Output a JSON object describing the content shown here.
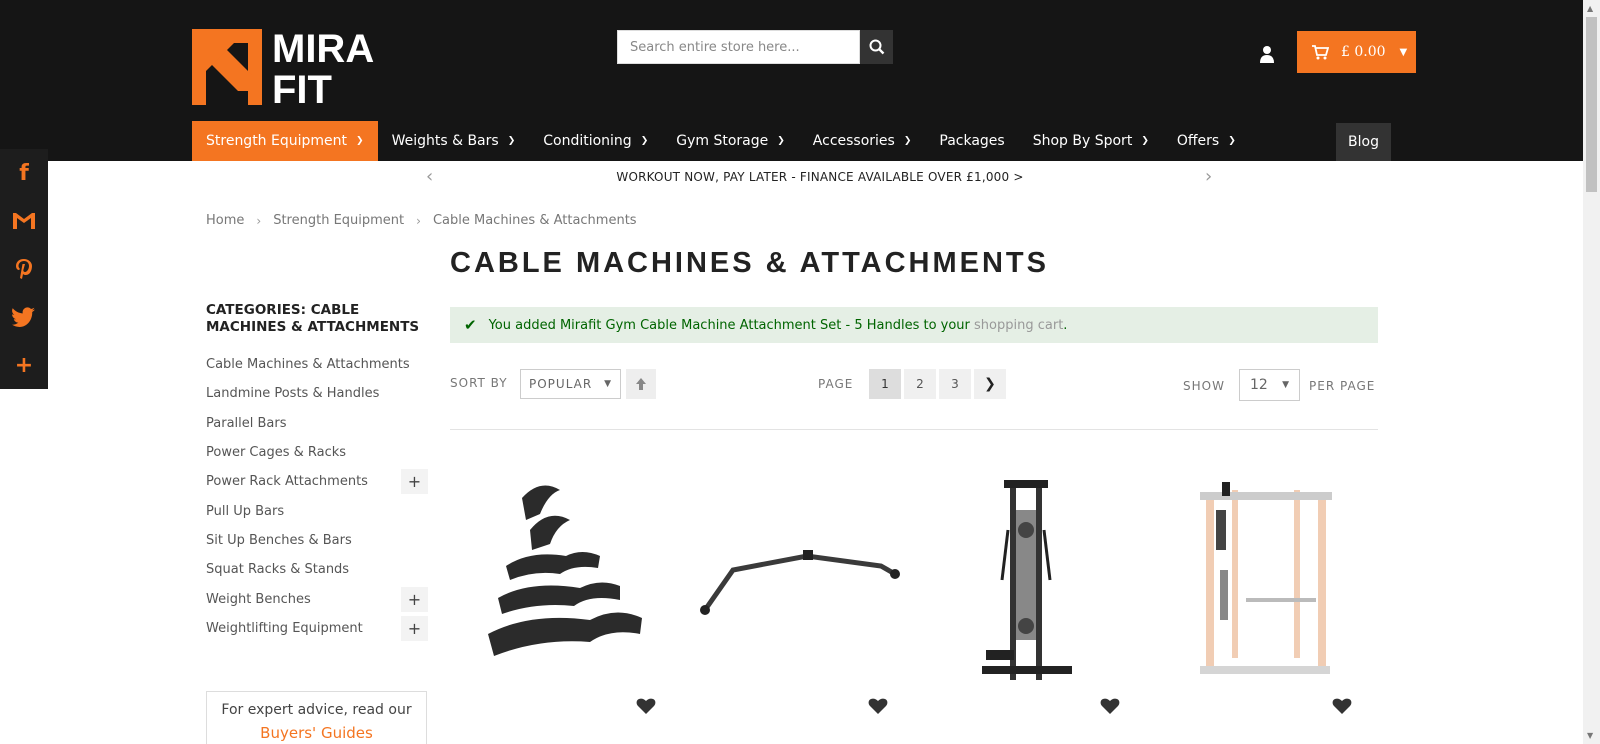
{
  "brand": {
    "logo_line1": "MIRA",
    "logo_line2": "FIT",
    "accent": "#f47521"
  },
  "search": {
    "placeholder": "Search entire store here..."
  },
  "cart": {
    "total": "£ 0.00"
  },
  "nav": {
    "items": [
      {
        "label": "Strength Equipment",
        "dropdown": true
      },
      {
        "label": "Weights & Bars",
        "dropdown": true
      },
      {
        "label": "Conditioning",
        "dropdown": true
      },
      {
        "label": "Gym Storage",
        "dropdown": true
      },
      {
        "label": "Accessories",
        "dropdown": true
      },
      {
        "label": "Packages",
        "dropdown": false
      },
      {
        "label": "Shop By Sport",
        "dropdown": true
      },
      {
        "label": "Offers",
        "dropdown": true
      }
    ],
    "blog": "Blog"
  },
  "promo": {
    "text": "WORKOUT NOW, PAY LATER - FINANCE AVAILABLE OVER £1,000 >"
  },
  "breadcrumb": [
    "Home",
    "Strength Equipment",
    "Cable Machines & Attachments"
  ],
  "page_title": "CABLE MACHINES & ATTACHMENTS",
  "sidebar": {
    "title": "CATEGORIES: CABLE MACHINES & ATTACHMENTS",
    "categories": [
      {
        "label": "Cable Machines & Attachments",
        "expandable": false
      },
      {
        "label": "Landmine Posts & Handles",
        "expandable": false
      },
      {
        "label": "Parallel Bars",
        "expandable": false
      },
      {
        "label": "Power Cages & Racks",
        "expandable": false
      },
      {
        "label": "Power Rack Attachments",
        "expandable": true
      },
      {
        "label": "Pull Up Bars",
        "expandable": false
      },
      {
        "label": "Sit Up Benches & Bars",
        "expandable": false
      },
      {
        "label": "Squat Racks & Stands",
        "expandable": false
      },
      {
        "label": "Weight Benches",
        "expandable": true
      },
      {
        "label": "Weightlifting Equipment",
        "expandable": true
      }
    ],
    "advice_text": "For expert advice, read our",
    "advice_link": "Buyers' Guides"
  },
  "message": {
    "text": "You added Mirafit Gym Cable Machine Attachment Set - 5 Handles to your ",
    "link": "shopping cart",
    "end": "."
  },
  "toolbar": {
    "sort_label": "SORT BY",
    "sort_value": "POPULAR",
    "page_label": "PAGE",
    "pages": [
      "1",
      "2",
      "3"
    ],
    "current_page": "1",
    "show_label": "SHOW",
    "show_value": "12",
    "per_page_label": "PER PAGE"
  },
  "products": [
    {
      "image": "cable-attachment-handles-set"
    },
    {
      "image": "lat-pulldown-bar"
    },
    {
      "image": "cable-tower-machine"
    },
    {
      "image": "power-cage-with-cable"
    }
  ],
  "social": [
    "facebook-icon",
    "gmail-icon",
    "pinterest-icon",
    "twitter-icon",
    "more-icon"
  ]
}
